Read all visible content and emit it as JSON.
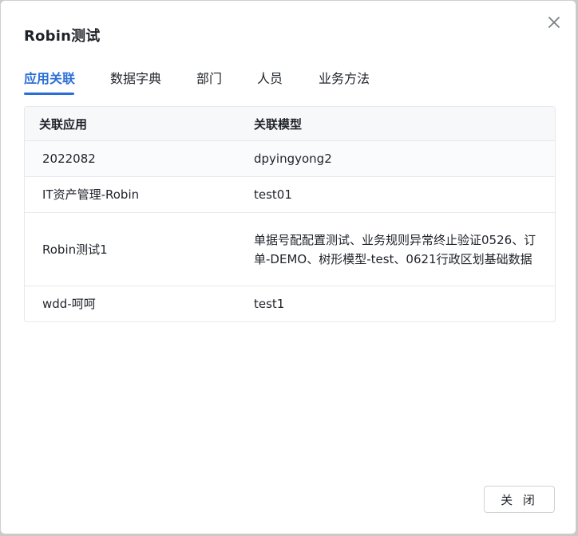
{
  "dialog": {
    "title": "Robin测试",
    "close_label": "关 闭"
  },
  "tabs": [
    {
      "label": "应用关联",
      "active": true
    },
    {
      "label": "数据字典",
      "active": false
    },
    {
      "label": "部门",
      "active": false
    },
    {
      "label": "人员",
      "active": false
    },
    {
      "label": "业务方法",
      "active": false
    }
  ],
  "table": {
    "headers": [
      "关联应用",
      "关联模型"
    ],
    "rows": [
      {
        "app": "2022082",
        "model": "dpyingyong2"
      },
      {
        "app": "IT资产管理-Robin",
        "model": "test01"
      },
      {
        "app": "Robin测试1",
        "model": "单据号配配置测试、业务规则异常终止验证0526、订单-DEMO、树形模型-test、0621行政区划基础数据"
      },
      {
        "app": "wdd-呵呵",
        "model": "test1"
      }
    ]
  },
  "icons": {
    "close": "close-icon"
  },
  "colors": {
    "accent": "#2b6fd6",
    "text": "#1f2329",
    "border": "#e6e8eb"
  }
}
